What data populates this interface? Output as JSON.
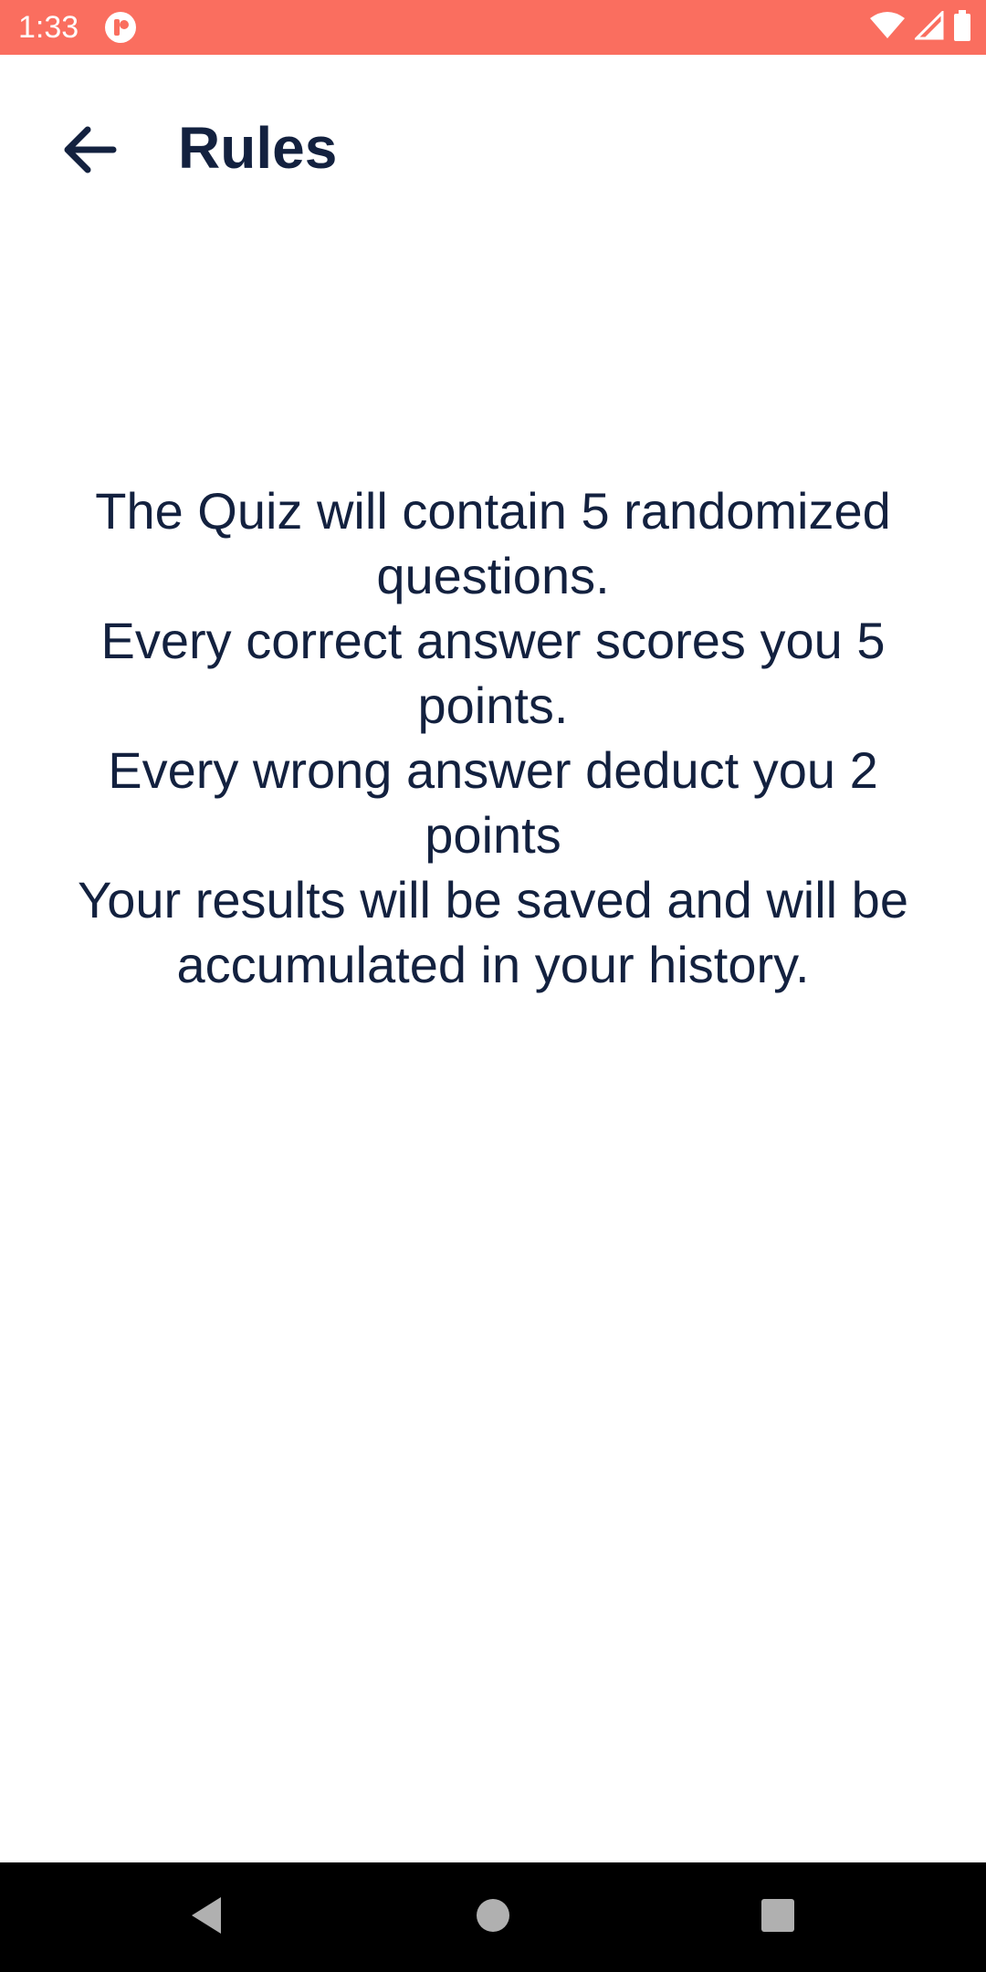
{
  "status_bar": {
    "time": "1:33",
    "app_icon": "notification-app-icon",
    "icons": [
      "wifi-icon",
      "cell-signal-icon",
      "battery-icon"
    ],
    "background_color": "#fa6e5f"
  },
  "app_bar": {
    "back_icon": "arrow-left-icon",
    "title": "Rules"
  },
  "rules": {
    "lines": [
      "The Quiz will contain 5 randomized questions.",
      "Every correct answer scores you 5 points.",
      "Every wrong answer deduct you 2 points",
      "Your results will be saved and will be accumulated in your history."
    ]
  },
  "nav_bar": {
    "buttons": [
      "back-triangle-icon",
      "home-circle-icon",
      "recents-square-icon"
    ]
  },
  "colors": {
    "text": "#13213f",
    "status_bar": "#fa6e5f",
    "nav_bar": "#000000"
  }
}
